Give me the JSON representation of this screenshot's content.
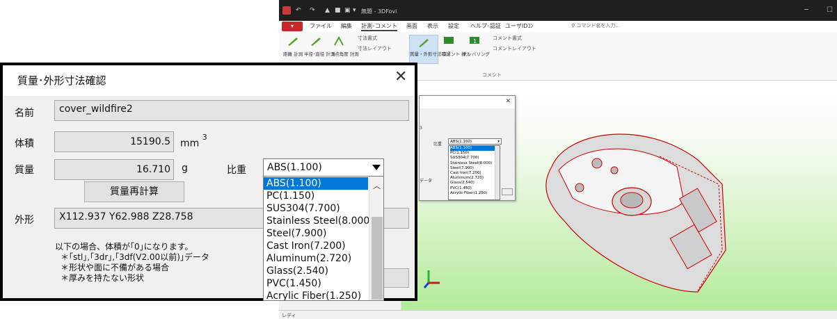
{
  "app": {
    "title": "無題 - 3DFovi",
    "menu": {
      "file": "ファイル",
      "items": [
        "編集",
        "計測･コメント",
        "画面",
        "表示",
        "設定",
        "ヘルプ･認証",
        "ユーザIDｺﾝ"
      ],
      "search_placeholder": "コマンド名を入力..."
    },
    "ribbon": {
      "measure_labels": [
        "距離 計測",
        "半径･直径 計測",
        "3点角度 計測"
      ],
      "small_items": [
        "寸法書式",
        "寸法レイアウト"
      ],
      "selected_label": "質量・外形寸法確認",
      "comment_labels": [
        "コメント 挿入",
        "ナンバリング"
      ],
      "comment_small": [
        "コメント書式",
        "コメントレイアウト"
      ],
      "group_comment": "コメント"
    },
    "status_text": "レディ"
  },
  "mini_dialog": {
    "label": "比重",
    "exp": "3",
    "data_text": "データ",
    "selected": "ABS(1.100)",
    "options": [
      "ABS(1.100)",
      "PC(1.150)",
      "SUS304(7.700)",
      "Stainless Steel(8.000)",
      "Steel(7.900)",
      "Cast Iron(7.200)",
      "Aluminum(2.720)",
      "Glass(2.540)",
      "PVC(1.450)",
      "Acrylic Fiber(1.250)"
    ]
  },
  "dialog": {
    "title": "質量･外形寸法確認",
    "name_label": "名前",
    "name_value": "cover_wildfire2",
    "volume_label": "体積",
    "volume_value": "15190.5",
    "volume_unit": "mm",
    "volume_exp": "3",
    "mass_label": "質量",
    "mass_value": "16.710",
    "mass_unit": "g",
    "density_label": "比重",
    "density_selected": "ABS(1.100)",
    "density_options": [
      "ABS(1.100)",
      "PC(1.150)",
      "SUS304(7.700)",
      "Stainless Steel(8.000)",
      "Steel(7.900)",
      "Cast Iron(7.200)",
      "Aluminum(2.720)",
      "Glass(2.540)",
      "PVC(1.450)",
      "Acrylic Fiber(1.250)"
    ],
    "recalc_button": "質量再計算",
    "bbox_label": "外形",
    "bbox_value": "X112.937 Y62.988 Z28.758",
    "notes": [
      "以下の場合、体積が｢0｣になります。",
      "＊｢stl｣,｢3dr｣,｢3df(V2.00以前)｣データ",
      "＊形状や面に不備がある場合",
      "＊厚みを持たない形状"
    ]
  }
}
